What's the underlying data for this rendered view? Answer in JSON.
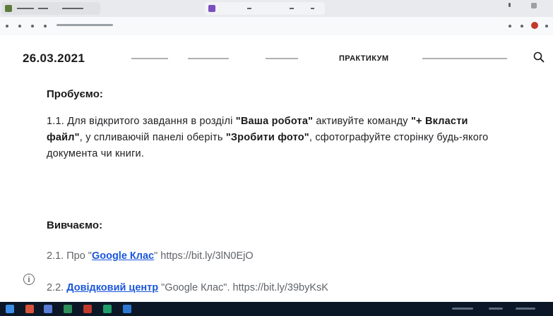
{
  "browser": {
    "tab_icons": [
      "site-favicon-icon",
      "tab-favicon-icon"
    ],
    "accent": "#5f6368"
  },
  "header": {
    "date": "26.03.2021",
    "nav": [
      {
        "label": "",
        "active": false
      },
      {
        "label": "",
        "active": false
      },
      {
        "label": "",
        "active": false
      },
      {
        "label": "ПРАКТИКУМ",
        "active": true
      },
      {
        "label": "",
        "active": false
      }
    ],
    "search_icon": "search-icon"
  },
  "content": {
    "heading_required": "Пробуємо:",
    "instruction": {
      "p1": "1.1. Для відкритого завдання в розділі ",
      "b1": "\"Ваша робота\"",
      "p2": " активуйте команду ",
      "b2": "\"+ Вкласти файл\"",
      "p3": ", у спливаючій панелі оберіть ",
      "b3": "\"Зробити фото\"",
      "p4": ", сфотографуйте сторінку будь-якого документа чи книги."
    },
    "heading_study": "Вивчаємо:",
    "links": [
      {
        "prefix": "2.1. Про \"",
        "link": "Google Клас",
        "suffix": "\" https://bit.ly/3lN0EjO"
      },
      {
        "prefix": "2.2. ",
        "link": "Довідковий центр",
        "suffix": " \"Google Клас\". https://bit.ly/39byKsK"
      }
    ],
    "link_color": "#1a56db"
  },
  "taskbar": {
    "icons": [
      "windows-start-icon",
      "search-taskbar-icon",
      "task-view-icon",
      "chrome-icon",
      "explorer-icon",
      "app-icon",
      "edge-icon"
    ]
  }
}
